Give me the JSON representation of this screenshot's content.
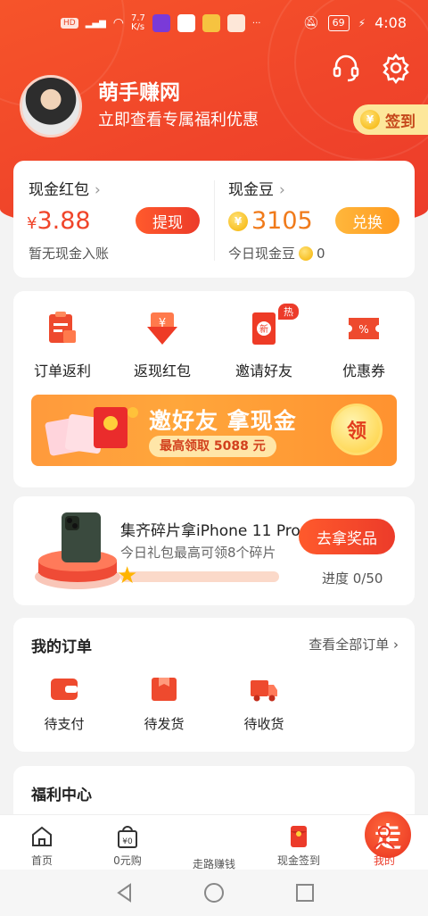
{
  "status": {
    "network": "HD",
    "speed": "7.7\nK/s",
    "battery": "69",
    "time": "4:08"
  },
  "profile": {
    "name": "萌手赚网",
    "subtitle": "立即查看专属福利优惠",
    "checkin_label": "签到",
    "coin_symbol": "¥"
  },
  "balance": {
    "cash": {
      "label": "现金红包",
      "currency": "¥",
      "amount": "3.88",
      "button": "提现",
      "note": "暂无现金入账"
    },
    "beans": {
      "label": "现金豆",
      "amount": "3105",
      "button": "兑换",
      "note": "今日现金豆",
      "today": "0"
    }
  },
  "actions": [
    {
      "label": "订单返利",
      "icon": "clipboard-icon"
    },
    {
      "label": "返现红包",
      "icon": "cashback-envelope-icon"
    },
    {
      "label": "邀请好友",
      "icon": "invite-envelope-icon",
      "badge": "热"
    },
    {
      "label": "优惠券",
      "icon": "coupon-icon"
    }
  ],
  "banner": {
    "title": "邀好友 拿现金",
    "pill": "最高领取 5088 元",
    "go": "领"
  },
  "promo": {
    "title": "集齐碎片拿iPhone 11 Pro",
    "subtitle": "今日礼包最高可领8个碎片",
    "button": "去拿奖品",
    "progress_text": "进度 0/50",
    "progress_value": 0
  },
  "orders": {
    "title": "我的订单",
    "view_all": "查看全部订单 ›",
    "items": [
      {
        "label": "待支付",
        "icon": "wallet-icon"
      },
      {
        "label": "待发货",
        "icon": "package-icon"
      },
      {
        "label": "待收货",
        "icon": "truck-icon"
      }
    ]
  },
  "welfare": {
    "title": "福利中心"
  },
  "tabs": [
    {
      "label": "首页",
      "icon": "home-icon"
    },
    {
      "label": "0元购",
      "icon": "bag-icon"
    },
    {
      "label": "走路赚钱",
      "icon": "walk-icon",
      "center_glyph": "走"
    },
    {
      "label": "现金签到",
      "icon": "red-envelope-icon"
    },
    {
      "label": "我的",
      "icon": "profile-icon",
      "active": true
    }
  ],
  "colors": {
    "brand": "#EC3B2A",
    "accent": "#FF9A3C",
    "gold": "#F5B200"
  }
}
